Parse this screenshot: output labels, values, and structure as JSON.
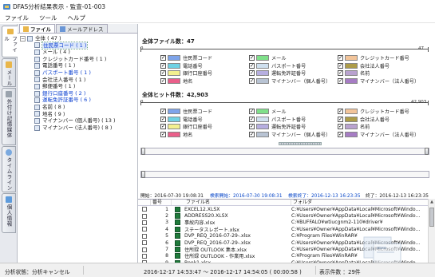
{
  "window": {
    "title": "DFAS分析結果表示 - 監査-01-003"
  },
  "menu": [
    "ファイル",
    "ツール",
    "ヘルプ"
  ],
  "side_tabs": [
    {
      "label": "ファイル",
      "color": "#e9b64a"
    },
    {
      "label": "メール",
      "color": "#e9b64a"
    },
    {
      "label": "外付け記憶媒体",
      "color": "#9aa3ad"
    },
    {
      "label": "タイムライン",
      "color": "#7aa9df"
    },
    {
      "label": "個人情報",
      "color": "#5d9bdc"
    }
  ],
  "sub_tabs": [
    "ファイル",
    "メールアドレス"
  ],
  "tree": {
    "root": "全体 ( 47 )",
    "items": [
      {
        "label": "住民票コード ( 1 )",
        "blue": true,
        "selected": true
      },
      {
        "label": "メール ( 4 )",
        "blue": false
      },
      {
        "label": "クレジットカード番号 ( 1 )",
        "blue": false
      },
      {
        "label": "電話番号 ( 1 )",
        "blue": false
      },
      {
        "label": "パスポート番号 ( 1 )",
        "blue": true
      },
      {
        "label": "会社法人番号 ( 1 )",
        "blue": false
      },
      {
        "label": "郵便番号 ( 1 )",
        "blue": false
      },
      {
        "label": "銀行口座番号 ( 2 )",
        "blue": true
      },
      {
        "label": "運転免許証番号 ( 6 )",
        "blue": true
      },
      {
        "label": "名前 ( 8 )",
        "blue": false
      },
      {
        "label": "地名 ( 9 )",
        "blue": false
      },
      {
        "label": "マイナンバー (個人番号) ( 13 )",
        "blue": false
      },
      {
        "label": "マイナンバー (法人番号) ( 8 )",
        "blue": false
      }
    ]
  },
  "file_section": {
    "title": "全体ファイル数：47",
    "scale_start": "0",
    "scale_end": "47"
  },
  "hit_section": {
    "title": "全体ヒット件数：42,903",
    "scale_start": "0",
    "scale_end": "42,903"
  },
  "legend": [
    {
      "label": "住民票コード",
      "color": "#7ea4ea"
    },
    {
      "label": "メール",
      "color": "#7fe08a"
    },
    {
      "label": "クレジットカード番号",
      "color": "#f2c49a"
    },
    {
      "label": "電話番号",
      "color": "#6fd2e4"
    },
    {
      "label": "パスポート番号",
      "color": "#cfe0ef"
    },
    {
      "label": "会社法人番号",
      "color": "#ad9c48"
    },
    {
      "label": "銀行口座番号",
      "color": "#f3f08e"
    },
    {
      "label": "運転免許証番号",
      "color": "#b6aee0"
    },
    {
      "label": "名前",
      "color": "#b9a2cf"
    },
    {
      "label": "地名",
      "color": "#ea5f8a"
    },
    {
      "label": "マイナンバー（個人番号）",
      "color": "#b8c3d3"
    },
    {
      "label": "マイナンバー（法人番号）",
      "color": "#a67cc4"
    }
  ],
  "timebar": {
    "start_label": "開始：2016-07-30 19:08:31",
    "analysis_start": "検索開始：2016-07-30 19:08:31",
    "analysis_end": "検索終了：2016-12-13 16:23:35",
    "end_label": "終了：2016-12-13 16:23:35"
  },
  "grid": {
    "headers": [
      "番号",
      "ファイル名",
      "フォルダ"
    ],
    "rows": [
      {
        "no": "1",
        "name": "EXCEL12.XLSX",
        "folder": "C:¥Users¥Owner¥AppData¥Local¥Microsoft¥Windo..."
      },
      {
        "no": "2",
        "name": "ADDRESS20.XLSX",
        "folder": "C:¥Users¥Owner¥AppData¥Local¥Microsoft¥Windo..."
      },
      {
        "no": "3",
        "name": "事故内容.xlsx",
        "folder": "C:¥BUFFALO¥wtiucgnm2-110¥driver¥"
      },
      {
        "no": "4",
        "name": "ステータスレポート.xlsx",
        "folder": "C:¥Users¥Owner¥AppData¥Local¥Microsoft¥Windo..."
      },
      {
        "no": "5",
        "name": "DVP_REQ_2016-07-29-.xlsx",
        "folder": "C:¥Program Files¥WinRAR¥"
      },
      {
        "no": "6",
        "name": "DVP_REQ_2016-07-29-.xlsx",
        "folder": "C:¥Users¥Owner¥AppData¥Local¥Microsoft¥Windo..."
      },
      {
        "no": "7",
        "name": "住所録 OUTLOOK 集本.xlsx",
        "folder": "C:¥Users¥Owner¥AppData¥Local¥Microsoft¥Windo..."
      },
      {
        "no": "8",
        "name": "住所録 OUTLOOK - 作業用.xlsx",
        "folder": "C:¥Program Files¥WinRAR¥"
      },
      {
        "no": "9",
        "name": "Book1.xlsx",
        "folder": "C:¥Users¥Owner¥AppData¥Local¥Microsoft¥Windo..."
      }
    ]
  },
  "status": {
    "state": "分析状態：分析キャンセル",
    "range": "2016-12-17 14:53:47 ～ 2016-12-17 14:54:05 ( 00:00:58 )",
    "display": "表示件数 ：29件"
  }
}
